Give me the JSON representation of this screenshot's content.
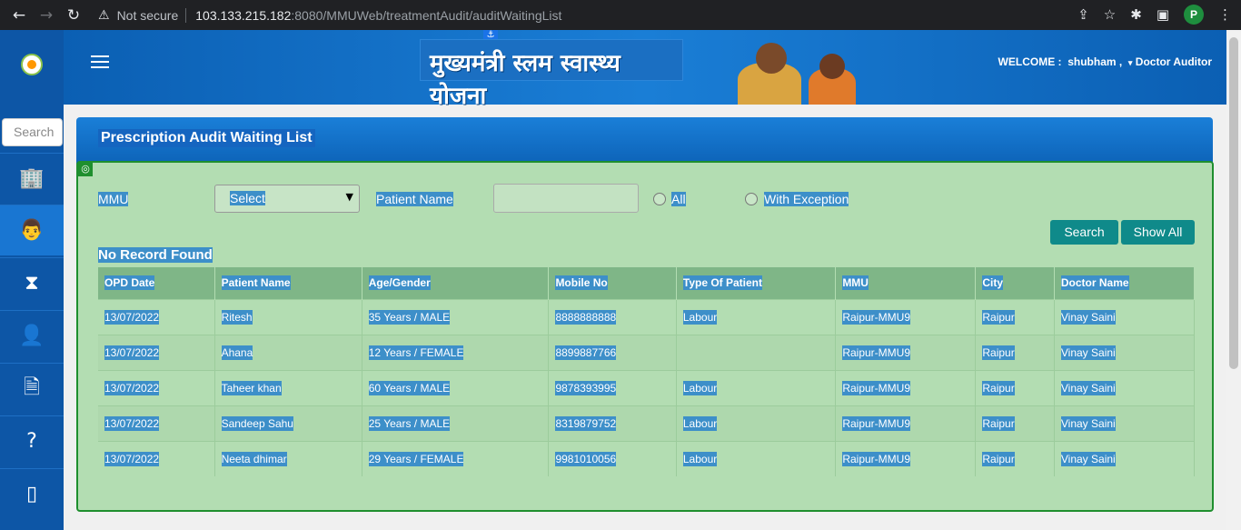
{
  "browser": {
    "security_label": "Not secure",
    "url_host": "103.133.215.182",
    "url_path": ":8080/MMUWeb/treatmentAudit/auditWaitingList",
    "profile_initial": "P"
  },
  "header": {
    "banner_text": "मुख्यमंत्री स्लम स्वास्थ्य योजना",
    "welcome_label": "WELCOME :",
    "user_name": "shubham ,",
    "role": "Doctor Auditor"
  },
  "sidebar": {
    "search_placeholder": "Search"
  },
  "panel": {
    "title": "Prescription Audit Waiting List"
  },
  "filters": {
    "mmu_label": "MMU",
    "mmu_selected": "Select",
    "patient_name_label": "Patient Name",
    "patient_name_value": "",
    "radio_all": "All",
    "radio_exception": "With Exception",
    "search_button": "Search",
    "show_all_button": "Show All"
  },
  "status_message": "No Record Found",
  "table": {
    "headers": [
      "OPD Date",
      "Patient Name",
      "Age/Gender",
      "Mobile No",
      "Type Of Patient",
      "MMU",
      "City",
      "Doctor Name"
    ],
    "rows": [
      [
        "13/07/2022",
        "Ritesh",
        "35 Years / MALE",
        "8888888888",
        "Labour",
        "Raipur-MMU9",
        "Raipur",
        "Vinay Saini"
      ],
      [
        "13/07/2022",
        "Ahana",
        "12 Years / FEMALE",
        "8899887766",
        "",
        "Raipur-MMU9",
        "Raipur",
        "Vinay Saini"
      ],
      [
        "13/07/2022",
        "Taheer khan",
        "60 Years / MALE",
        "9878393995",
        "Labour",
        "Raipur-MMU9",
        "Raipur",
        "Vinay Saini"
      ],
      [
        "13/07/2022",
        "Sandeep Sahu",
        "25 Years / MALE",
        "8319879752",
        "Labour",
        "Raipur-MMU9",
        "Raipur",
        "Vinay Saini"
      ],
      [
        "13/07/2022",
        "Neeta dhimar",
        "29 Years / FEMALE",
        "9981010056",
        "Labour",
        "Raipur-MMU9",
        "Raipur",
        "Vinay Saini"
      ]
    ]
  }
}
